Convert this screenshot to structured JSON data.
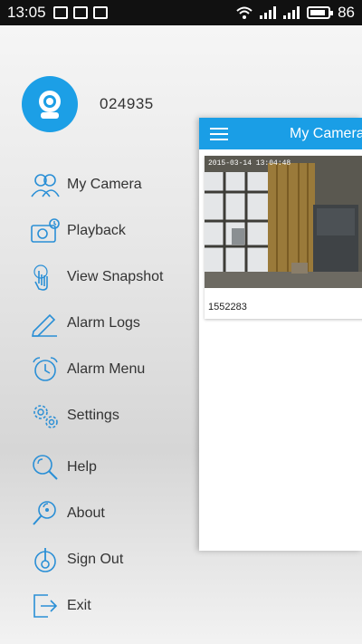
{
  "status_bar": {
    "time": "13:05",
    "battery": "86"
  },
  "profile": {
    "user_id": "024935"
  },
  "menu": {
    "items": [
      {
        "label": "My Camera",
        "icon": "my-camera-icon"
      },
      {
        "label": "Playback",
        "icon": "playback-icon"
      },
      {
        "label": "View Snapshot",
        "icon": "view-snapshot-icon"
      },
      {
        "label": "Alarm Logs",
        "icon": "alarm-logs-icon"
      },
      {
        "label": "Alarm Menu",
        "icon": "alarm-menu-icon"
      },
      {
        "label": "Settings",
        "icon": "settings-icon"
      },
      {
        "label": "Help",
        "icon": "help-icon"
      },
      {
        "label": "About",
        "icon": "about-icon"
      },
      {
        "label": "Sign Out",
        "icon": "sign-out-icon"
      },
      {
        "label": "Exit",
        "icon": "exit-icon"
      }
    ]
  },
  "main": {
    "title": "My Camera",
    "camera_card": {
      "name": "1552283",
      "overlay_text": "2015-03-14  13:04:48"
    }
  },
  "colors": {
    "accent": "#1a9ee6",
    "icon": "#2a8fd6"
  }
}
